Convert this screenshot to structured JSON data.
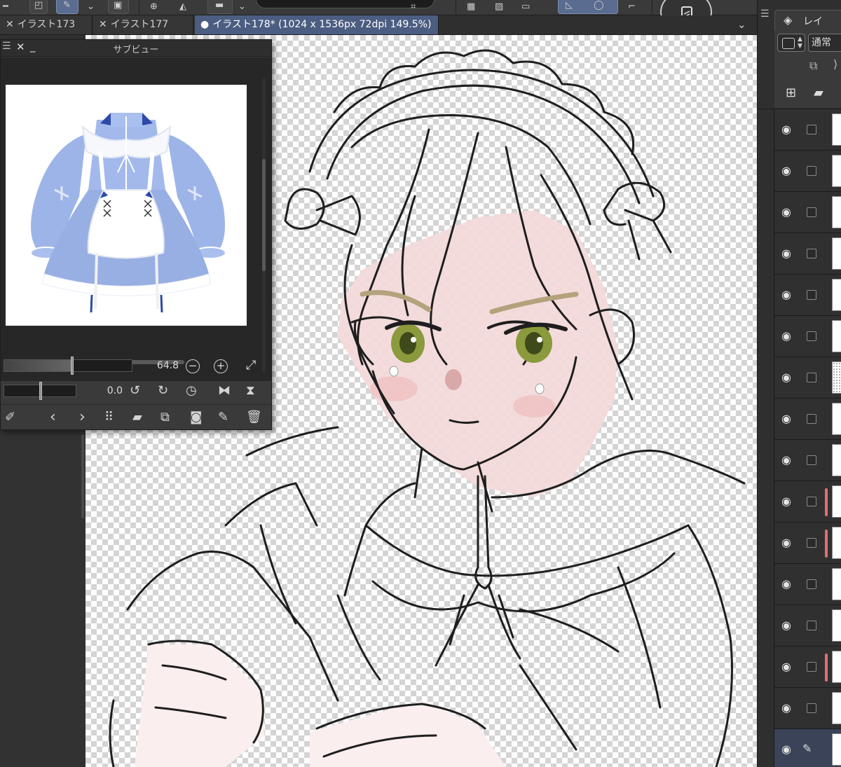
{
  "toolbar": {
    "icons": [
      "menu-icon",
      "export-icon",
      "pen-icon",
      "chevron-down-icon",
      "stamp-icon",
      "layer-add-icon",
      "fill-icon",
      "ruler-icon",
      "chevron-down-icon",
      "crop-icon",
      "grid-icon",
      "eraser-icon",
      "select-icon",
      "lasso-icon",
      "corner-icon",
      "rotate-canvas-icon"
    ]
  },
  "tabs": [
    {
      "close": "✕",
      "label": "イラスト173",
      "active": false
    },
    {
      "close": "✕",
      "label": "イラスト177",
      "active": false
    },
    {
      "close": "●",
      "label": "イラスト178* (1024 x 1536px 72dpi 149.5%)",
      "active": true
    }
  ],
  "subview": {
    "title": "サブビュー",
    "zoom_value": "64.8",
    "zoom_fraction": 0.53,
    "rotation_value": "0.0",
    "rotation_fraction": 0.5,
    "reference_image": "blue-maid-dress"
  },
  "layer_panel": {
    "tab_label": "レイ",
    "blend_mode": "通常",
    "layers": [
      {
        "mark_color": "",
        "pattern": false,
        "selected": false
      },
      {
        "mark_color": "",
        "pattern": false,
        "selected": false
      },
      {
        "mark_color": "",
        "pattern": false,
        "selected": false
      },
      {
        "mark_color": "",
        "pattern": false,
        "selected": false
      },
      {
        "mark_color": "",
        "pattern": false,
        "selected": false
      },
      {
        "mark_color": "",
        "pattern": false,
        "selected": false
      },
      {
        "mark_color": "",
        "pattern": true,
        "selected": false
      },
      {
        "mark_color": "",
        "pattern": false,
        "selected": false
      },
      {
        "mark_color": "",
        "pattern": false,
        "selected": false
      },
      {
        "mark_color": "#e07070",
        "pattern": false,
        "selected": false
      },
      {
        "mark_color": "#e07070",
        "pattern": false,
        "selected": false
      },
      {
        "mark_color": "",
        "pattern": false,
        "selected": false
      },
      {
        "mark_color": "",
        "pattern": false,
        "selected": false
      },
      {
        "mark_color": "#e07070",
        "pattern": false,
        "selected": false
      },
      {
        "mark_color": "",
        "pattern": false,
        "selected": false
      },
      {
        "mark_color": "",
        "pattern": false,
        "selected": true
      }
    ]
  },
  "colors": {
    "accent": "#4c5d82",
    "eye_green": "#7a8a3a",
    "skin": "#f4dcdc",
    "dress_blue": "#9db4e8"
  }
}
